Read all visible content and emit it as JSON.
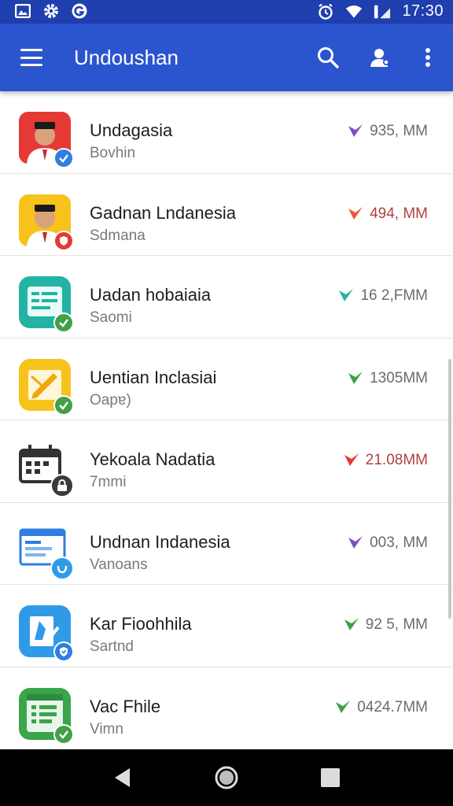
{
  "status_bar": {
    "time": "17:30",
    "left_icons": [
      "gallery-icon",
      "settings-icon",
      "g-icon"
    ],
    "right_icons": [
      "alarm-icon",
      "wifi-icon",
      "signal-icon",
      "battery-icon"
    ]
  },
  "app_bar": {
    "title": "Undoushan",
    "actions": [
      "search-icon",
      "account-icon",
      "more-vert-icon"
    ],
    "color": "#2b55cf"
  },
  "items": [
    {
      "title": "Undagasia",
      "subtitle": "Bovhin",
      "size": "935, MM",
      "size_color": "#6b6b6b",
      "chevron_color": "#7b4fc4",
      "icon": "portrait-icon",
      "icon_bg": "#e53935",
      "badge": "check-badge-icon",
      "badge_color": "#2f7de1"
    },
    {
      "title": "Gadnan Lndanesia",
      "subtitle": "Sdmana",
      "size": "494, MM",
      "size_color": "#b04040",
      "chevron_color": "#e85a3b",
      "icon": "portrait-icon",
      "icon_bg": "#f7c21c",
      "badge": "shield-badge-icon",
      "badge_color": "#e53935"
    },
    {
      "title": "Uadan hobaiaia",
      "subtitle": "Saomi",
      "size": "16 2,FMM",
      "size_color": "#6b6b6b",
      "chevron_color": "#24b3a4",
      "icon": "document-icon",
      "icon_bg": "#22b3a2",
      "badge": "check-badge-icon",
      "badge_color": "#43a047"
    },
    {
      "title": "Uentian Inclasiai",
      "subtitle": "Oapɐ)",
      "size": "1305MM",
      "size_color": "#6b6b6b",
      "chevron_color": "#43a047",
      "icon": "edit-note-icon",
      "icon_bg": "#f7c21c",
      "badge": "check-badge-icon",
      "badge_color": "#43a047"
    },
    {
      "title": "Yekoala Nadatia",
      "subtitle": "7mmi",
      "size": "21.08MM",
      "size_color": "#b04040",
      "chevron_color": "#e53935",
      "icon": "calendar-lock-icon",
      "icon_bg": "#ffffff",
      "badge": "lock-badge-icon",
      "badge_color": "#3a3a3a"
    },
    {
      "title": "Undnan Indanesia",
      "subtitle": "Vanoans",
      "size": "003, MM",
      "size_color": "#6b6b6b",
      "chevron_color": "#7b4fc4",
      "icon": "browser-window-icon",
      "icon_bg": "#ffffff",
      "badge": "shield-badge-icon",
      "badge_color": "#2f9be8"
    },
    {
      "title": "Kar Fioohhila",
      "subtitle": "Sartnd",
      "size": "92 5, MM",
      "size_color": "#6b6b6b",
      "chevron_color": "#43a047",
      "icon": "edit-doc-icon",
      "icon_bg": "#2f9be8",
      "badge": "shield-badge-icon",
      "badge_color": "#2f7de1"
    },
    {
      "title": "Vac Fhile",
      "subtitle": "Vimn",
      "size": "0424.7MM",
      "size_color": "#6b6b6b",
      "chevron_color": "#43a047",
      "icon": "spreadsheet-icon",
      "icon_bg": "#3aa54a",
      "badge": "check-badge-icon",
      "badge_color": "#43a047"
    }
  ],
  "nav_bar": {
    "buttons": [
      "back-icon",
      "home-icon",
      "recents-icon"
    ]
  }
}
